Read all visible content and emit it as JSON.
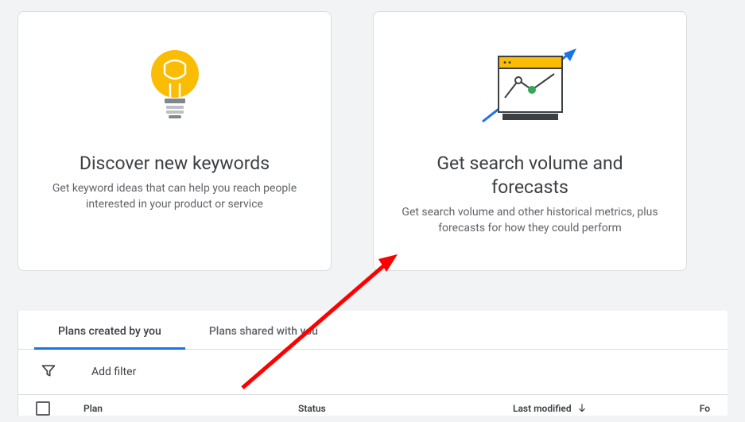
{
  "cards": {
    "discover": {
      "title": "Discover new keywords",
      "desc": "Get keyword ideas that can help you reach people interested in your product or service"
    },
    "forecasts": {
      "title": "Get search volume and forecasts",
      "desc": "Get search volume and other historical metrics, plus forecasts for how they could perform"
    }
  },
  "tabs": {
    "created": "Plans created by you",
    "shared": "Plans shared with you"
  },
  "filter": {
    "add_label": "Add filter"
  },
  "table": {
    "headers": {
      "plan": "Plan",
      "status": "Status",
      "last_modified": "Last modified",
      "forecast": "Fo"
    }
  }
}
